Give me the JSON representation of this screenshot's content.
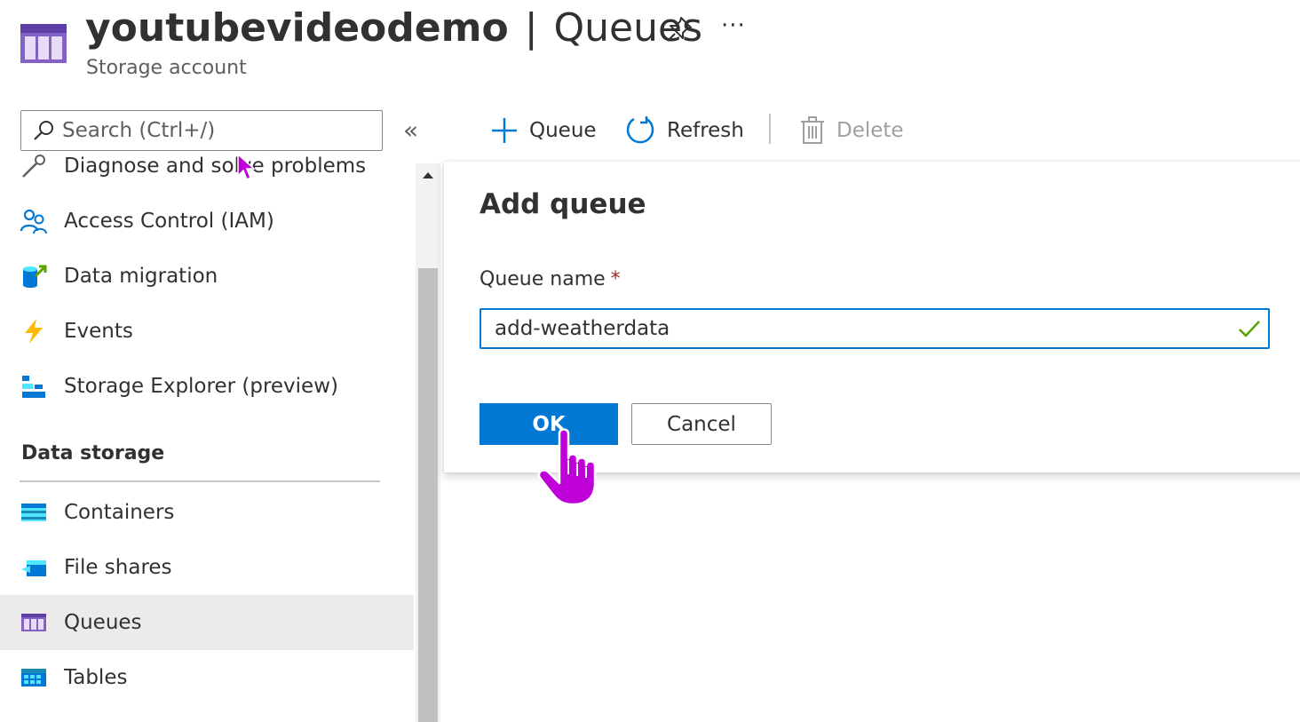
{
  "header": {
    "resource_name": "youtubevideodemo",
    "separator": "|",
    "section_name": "Queues",
    "subtitle": "Storage account",
    "more_label": "···"
  },
  "search": {
    "placeholder": "Search (Ctrl+/)"
  },
  "sidebar": {
    "collapse_label": "«",
    "partial_item_label": "Diagnose and solve problems",
    "items": [
      {
        "label": "Access Control (IAM)",
        "icon": "people-icon"
      },
      {
        "label": "Data migration",
        "icon": "data-migration-icon"
      },
      {
        "label": "Events",
        "icon": "lightning-icon"
      },
      {
        "label": "Storage Explorer (preview)",
        "icon": "storage-explorer-icon"
      }
    ],
    "section_title": "Data storage",
    "storage_items": [
      {
        "label": "Containers",
        "icon": "containers-icon"
      },
      {
        "label": "File shares",
        "icon": "file-shares-icon"
      },
      {
        "label": "Queues",
        "icon": "queues-icon",
        "selected": true
      },
      {
        "label": "Tables",
        "icon": "tables-icon"
      }
    ]
  },
  "toolbar": {
    "queue_label": "Queue",
    "refresh_label": "Refresh",
    "delete_label": "Delete"
  },
  "dialog": {
    "title": "Add queue",
    "field_label": "Queue name",
    "required_marker": "*",
    "field_value": "add-weatherdata",
    "ok_label": "OK",
    "cancel_label": "Cancel"
  },
  "colors": {
    "accent": "#0078d4",
    "selected_bg": "#edebe9",
    "required": "#a4262c",
    "valid_check": "#57a300",
    "queue_icon": "#8661c5",
    "cursor": "#c000d8"
  }
}
